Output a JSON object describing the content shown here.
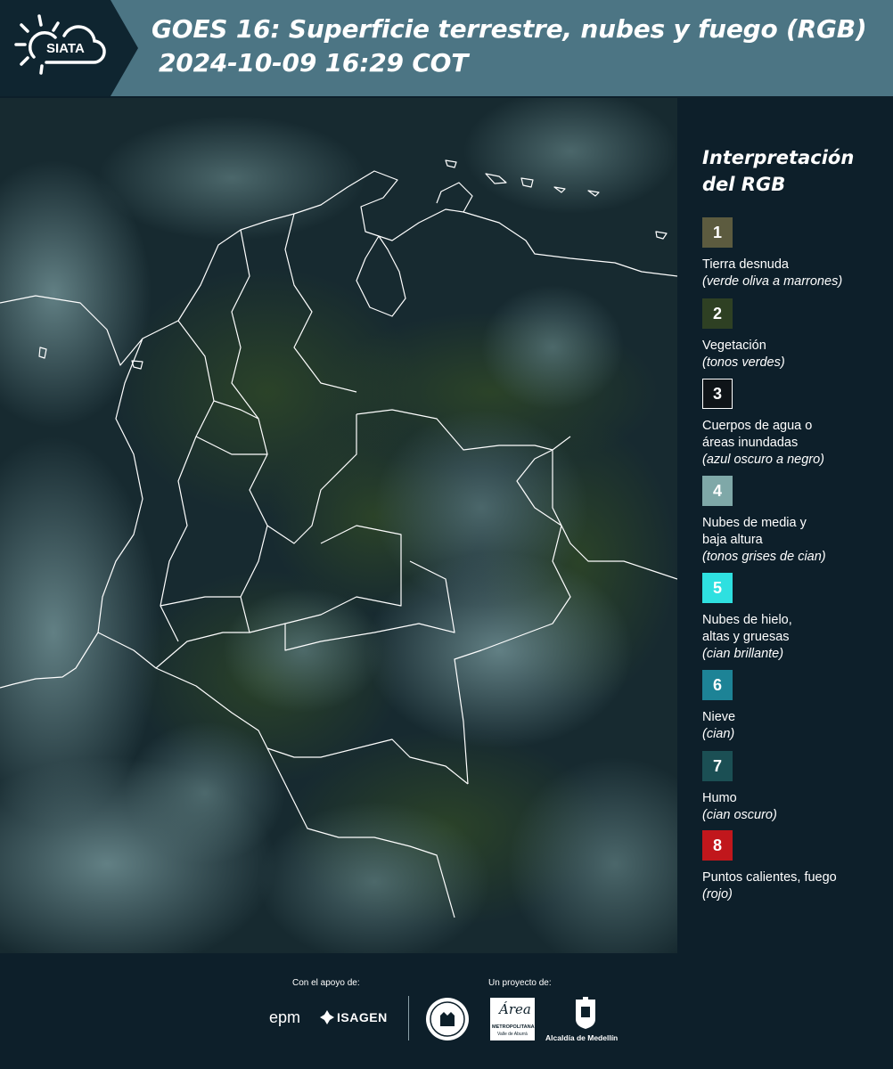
{
  "header": {
    "title_line1": "GOES 16: Superficie terrestre, nubes y fuego (RGB)",
    "title_line2": "2024-10-09 16:29 COT",
    "logo_text": "SIATA"
  },
  "legend": {
    "title": "Interpretación del RGB",
    "items": [
      {
        "num": "1",
        "label": "Tierra desnuda",
        "note": "(verde oliva a marrones)",
        "color": "#5c5b3f"
      },
      {
        "num": "2",
        "label": "Vegetación",
        "note": "(tonos verdes)",
        "color": "#2e4023"
      },
      {
        "num": "3",
        "label": "Cuerpos de agua o\náreas inundadas",
        "note": "(azul oscuro a negro)",
        "color": "#0f1418"
      },
      {
        "num": "4",
        "label": "Nubes de media y\nbaja altura",
        "note": "(tonos grises de cian)",
        "color": "#7fa8a8"
      },
      {
        "num": "5",
        "label": "Nubes de hielo,\naltas y gruesas",
        "note": "(cian brillante)",
        "color": "#2ee0e0"
      },
      {
        "num": "6",
        "label": "Nieve",
        "note": "(cian)",
        "color": "#1d8396"
      },
      {
        "num": "7",
        "label": "Humo",
        "note": "(cian oscuro)",
        "color": "#1b4f54"
      },
      {
        "num": "8",
        "label": "Puntos calientes, fuego",
        "note": "(rojo)",
        "color": "#c1171c"
      }
    ]
  },
  "footer": {
    "support_caption": "Con el apoyo de:",
    "project_caption": "Un proyecto de:",
    "logo_epm": "epm",
    "logo_isagen": "ISAGEN",
    "logo_area": "Área",
    "logo_area_sub": "METROPOLITANA",
    "logo_area_sub2": "Valle de Aburrá",
    "logo_alcaldia": "Alcaldía de Medellín"
  }
}
